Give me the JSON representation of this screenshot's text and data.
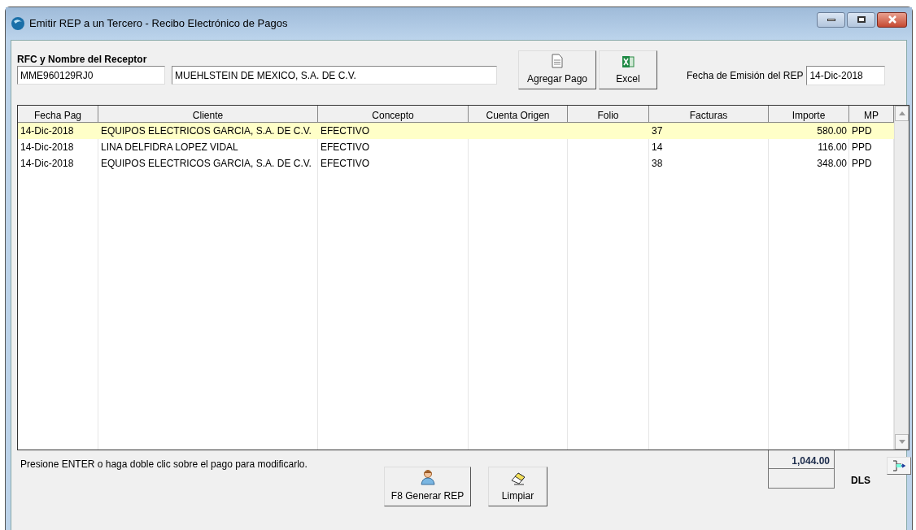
{
  "window": {
    "title": "Emitir REP a un Tercero - Recibo Electrónico de Pagos"
  },
  "receptor": {
    "label": "RFC y Nombre del Receptor",
    "rfc": "MME960129RJ0",
    "nombre": "MUEHLSTEIN DE MEXICO, S.A. DE C.V."
  },
  "toolbar": [
    {
      "kind": "document",
      "label": "Agregar Pago"
    },
    {
      "kind": "excel",
      "label": "Excel"
    }
  ],
  "fecha_emision": {
    "label": "Fecha de Emisión del REP",
    "value": "14-Dic-2018"
  },
  "table": {
    "columns": [
      "Fecha Pag",
      "Cliente",
      "Concepto",
      "Cuenta Origen",
      "Folio",
      "Facturas",
      "Importe",
      "MP"
    ],
    "rows": [
      {
        "selected": true,
        "cells": [
          "14-Dic-2018",
          "EQUIPOS ELECTRICOS GARCIA, S.A. DE C.V.",
          "EFECTIVO",
          "",
          "",
          "37",
          "580.00",
          "PPD"
        ]
      },
      {
        "selected": false,
        "cells": [
          "14-Dic-2018",
          "LINA DELFIDRA LOPEZ VIDAL",
          "EFECTIVO",
          "",
          "",
          "14",
          "116.00",
          "PPD"
        ]
      },
      {
        "selected": false,
        "cells": [
          "14-Dic-2018",
          "EQUIPOS ELECTRICOS GARCIA, S.A. DE C.V.",
          "EFECTIVO",
          "",
          "",
          "38",
          "348.00",
          "PPD"
        ]
      }
    ]
  },
  "hint": "Presione ENTER o haga doble clic sobre el pago para modificarlo.",
  "actions": [
    {
      "kind": "person",
      "label": "F8 Generar REP"
    },
    {
      "kind": "eraser",
      "label": "Limpiar"
    }
  ],
  "totals": {
    "total": "1,044.00",
    "currency": "DLS"
  }
}
